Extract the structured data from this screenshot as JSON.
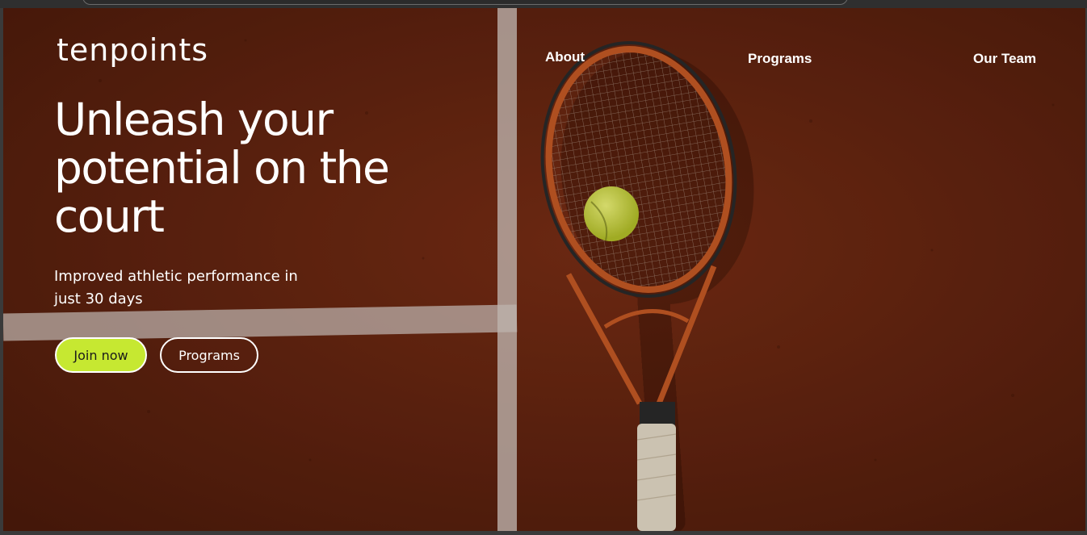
{
  "brand": {
    "logo_text": "tenpoints"
  },
  "nav": {
    "about": "About",
    "programs": "Programs",
    "team": "Our Team"
  },
  "hero": {
    "headline": "Unleash your potential on the court",
    "subtitle": "Improved athletic performance in just 30 days",
    "primary_button": "Join now",
    "secondary_button": "Programs"
  },
  "colors": {
    "accent": "#c6e831",
    "court": "#6a2612",
    "text": "#ffffff"
  }
}
